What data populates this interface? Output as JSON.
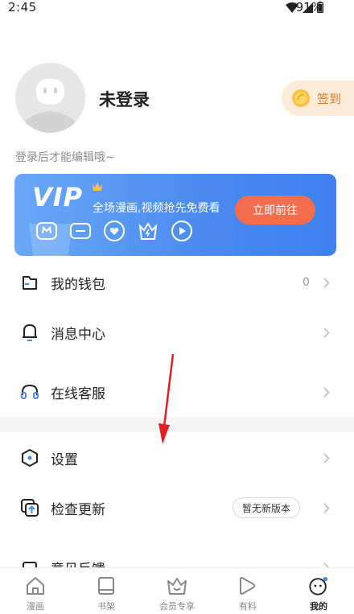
{
  "status_bar": {
    "time": "2:45",
    "battery": "91%"
  },
  "profile": {
    "username": "未登录",
    "signin_label": "签到",
    "login_hint": "登录后才能编辑哦~"
  },
  "vip": {
    "title": "VIP",
    "description": "全场漫画,视频抢先免费看",
    "button_label": "立即前往"
  },
  "menu": {
    "wallet": {
      "label": "我的钱包",
      "value": "0"
    },
    "messages": {
      "label": "消息中心"
    },
    "support": {
      "label": "在线客服"
    },
    "settings": {
      "label": "设置"
    },
    "update": {
      "label": "检查更新",
      "badge": "暂无新版本"
    },
    "feedback": {
      "label": "意见反馈"
    }
  },
  "tabs": [
    {
      "label": "漫画",
      "icon": "home-icon"
    },
    {
      "label": "书架",
      "icon": "bookshelf-icon"
    },
    {
      "label": "会员专享",
      "icon": "vip-crown-icon"
    },
    {
      "label": "有料",
      "icon": "play-icon"
    },
    {
      "label": "我的",
      "icon": "profile-face-icon",
      "active": true
    }
  ],
  "colors": {
    "vip_gradient_start": "#69a8f8",
    "vip_gradient_end": "#3d80ee",
    "vip_button": "#f46d4f",
    "signin_bg": "#fdebd9",
    "signin_text": "#d27a2c",
    "annotation_arrow": "#e02020"
  }
}
